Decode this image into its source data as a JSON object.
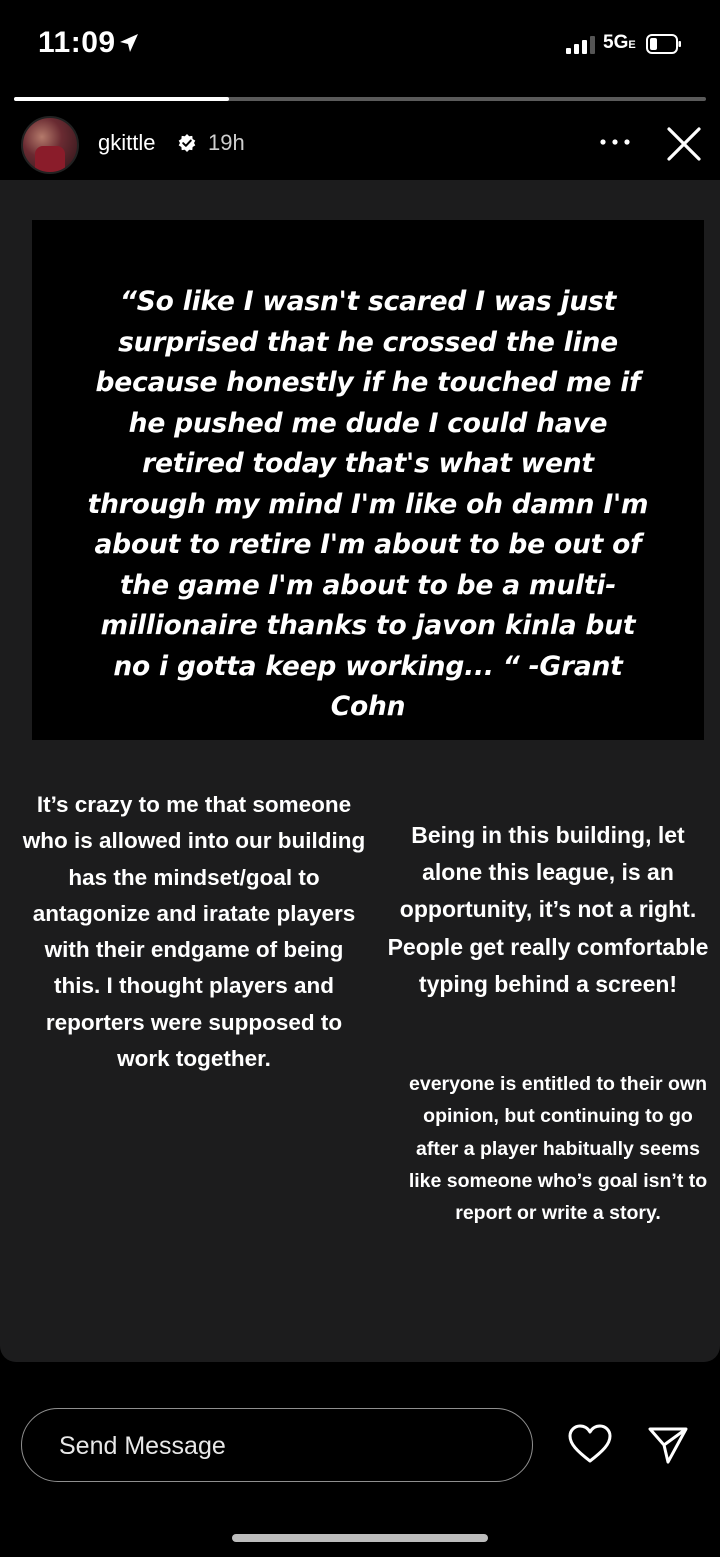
{
  "status_bar": {
    "time": "11:09",
    "network": "5G",
    "network_suffix": "E",
    "location_icon": "location-arrow-icon",
    "signal_icon": "signal-bars-icon",
    "battery_icon": "battery-low-icon"
  },
  "story": {
    "progress": 0.31,
    "username": "gkittle",
    "verified_icon": "verified-badge-icon",
    "time_ago": "19h",
    "more_icon": "more-dots-icon",
    "close_icon": "close-icon",
    "quote": "“So like I wasn't scared I was just surprised that he crossed the line because honestly if he touched me if he pushed me dude I could have retired today that's what went through my mind I'm like oh damn I'm about to retire I'm about to be out of the game I'm about to be a multi-millionaire thanks to javon kinla but no i gotta keep working... “ -Grant Cohn",
    "left_text": "It’s crazy to me that someone who is allowed into our building has the mindset/goal to antagonize and iratate players with their endgame of being this. I thought players and reporters were supposed to work together.",
    "right_text": "Being in this building, let alone this league, is an opportunity, it’s not a right. People get really comfortable typing behind a screen!",
    "right_small_text": "everyone is entitled to their own opinion, but continuing to go after a player habitually seems like someone who’s goal isn’t to report or write a story."
  },
  "footer": {
    "send_placeholder": "Send Message",
    "like_icon": "heart-icon",
    "share_icon": "send-arrow-icon"
  },
  "colors": {
    "background": "#000000",
    "card": "#1c1c1d",
    "text": "#ffffff",
    "muted": "#cfcfcf"
  }
}
